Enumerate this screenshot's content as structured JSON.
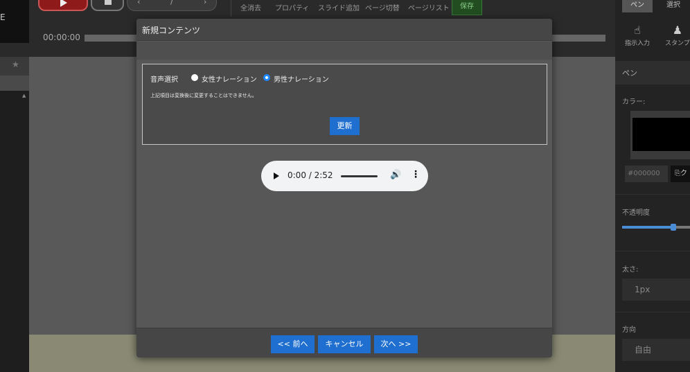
{
  "toolbar": {
    "logo_text": "E",
    "items": [
      "全消去",
      "プロパティ",
      "スライド追加",
      "ページ切替",
      "ページリスト"
    ],
    "save_label": "保存",
    "time": "00:00:00"
  },
  "right_panel": {
    "tabs": [
      "ペン",
      "選択"
    ],
    "tools": [
      "指示入力",
      "スタンプ"
    ],
    "section_title": "ペン",
    "color_label": "カラー:",
    "color_hex": "#000000",
    "copy_label": "ク",
    "opacity_label": "不透明度",
    "opacity_value": 0.76,
    "width_label": "太さ:",
    "width_value": "1px",
    "direction_label": "方向",
    "direction_value": "自由"
  },
  "modal": {
    "title": "新規コンテンツ",
    "voice": {
      "label": "音声選択",
      "options": [
        {
          "label": "女性ナレーション",
          "checked": false
        },
        {
          "label": "男性ナレーション",
          "checked": true
        }
      ],
      "note": "上記項目は変換後に変更することはできません。",
      "update_label": "更新"
    },
    "audio": {
      "time": "0:00 / 2:52"
    },
    "footer": {
      "prev_label": "<< 前へ",
      "cancel_label": "キャンセル",
      "next_label": "次へ >>"
    }
  },
  "colors": {
    "accent": "#1f6fd0",
    "radio_checked": "#1e88ff",
    "modal_bg": "#575757"
  }
}
